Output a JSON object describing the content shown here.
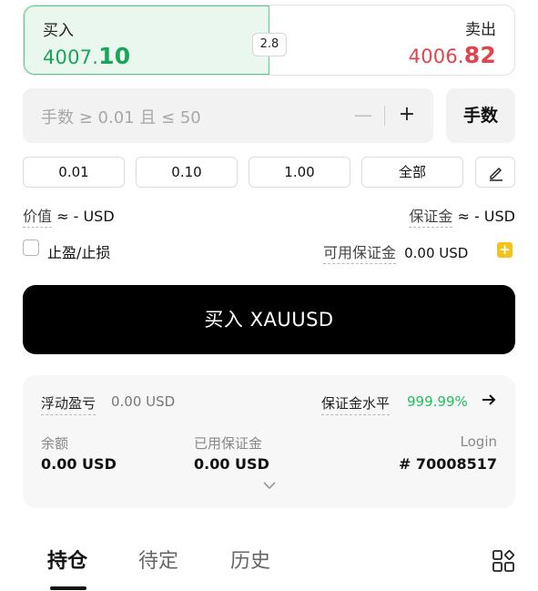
{
  "price_panel": {
    "buy_label": "买入",
    "buy_price_main": "4007.",
    "buy_price_end": "10",
    "sell_label": "卖出",
    "sell_price_main": "4006.",
    "sell_price_end": "82",
    "spread": "2.8",
    "buy_color": "#1aa55a",
    "sell_color": "#e0444c"
  },
  "quantity": {
    "placeholder": "手数 ≥ 0.01 且 ≤ 50",
    "minus": "—",
    "plus": "+",
    "unit_label": "手数"
  },
  "presets": [
    "0.01",
    "0.10",
    "1.00",
    "全部"
  ],
  "value_row": {
    "value_label": "价值",
    "value_text": "≈ - USD",
    "margin_label": "保证金",
    "margin_text": "≈ - USD"
  },
  "tp_sl": {
    "label": "止盈/止损",
    "available_label": "可用保证金",
    "available_value": "0.00 USD",
    "add_symbol": "+"
  },
  "submit": {
    "label": "买入 XAUUSD"
  },
  "account": {
    "floating_pl_label": "浮动盈亏",
    "floating_pl_value": "0.00 USD",
    "margin_level_label": "保证金水平",
    "margin_level_value": "999.99%",
    "balance_label": "余额",
    "balance_value": "0.00 USD",
    "used_margin_label": "已用保证金",
    "used_margin_value": "0.00 USD",
    "login_label": "Login",
    "login_value": "# 70008517",
    "positive_color": "#1ec05c"
  },
  "tabs": [
    {
      "label": "持仓",
      "active": true
    },
    {
      "label": "待定",
      "active": false
    },
    {
      "label": "历史",
      "active": false
    }
  ],
  "icons": [
    "edit-icon",
    "arrow-right-icon",
    "chevron-down-icon",
    "grid-layout-icon"
  ]
}
